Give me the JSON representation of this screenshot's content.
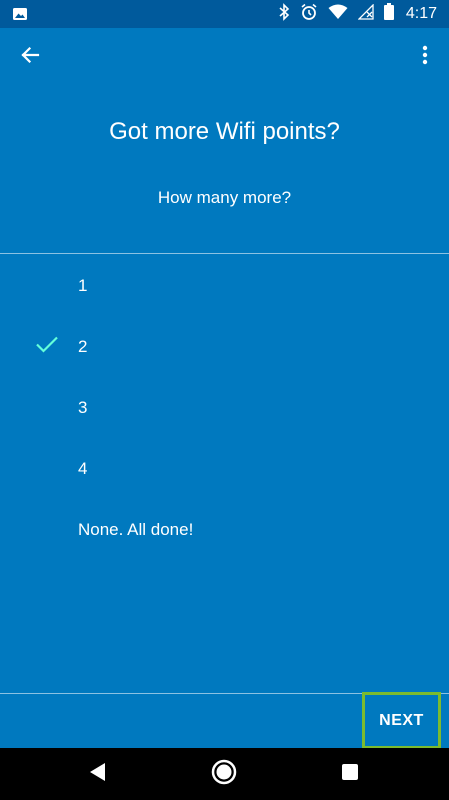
{
  "status_bar": {
    "time": "4:17",
    "icons": [
      "photo-icon",
      "bluetooth-icon",
      "alarm-icon",
      "wifi-icon",
      "no-signal-icon",
      "battery-icon"
    ]
  },
  "app_bar": {
    "back_icon": "arrow-back-icon",
    "menu_icon": "more-vert-icon"
  },
  "title": "Got more Wifi points?",
  "subtitle": "How many more?",
  "options": [
    {
      "label": "1",
      "selected": false
    },
    {
      "label": "2",
      "selected": true
    },
    {
      "label": "3",
      "selected": false
    },
    {
      "label": "4",
      "selected": false
    },
    {
      "label": "None. All done!",
      "selected": false
    }
  ],
  "next_button": "NEXT",
  "colors": {
    "background": "#0079bf",
    "status_bar": "#005a9c",
    "check": "#64ffda",
    "highlight_border": "#7cbb2f"
  },
  "nav_bar": {
    "back": "nav-back-icon",
    "home": "nav-home-icon",
    "recents": "nav-recents-icon"
  }
}
